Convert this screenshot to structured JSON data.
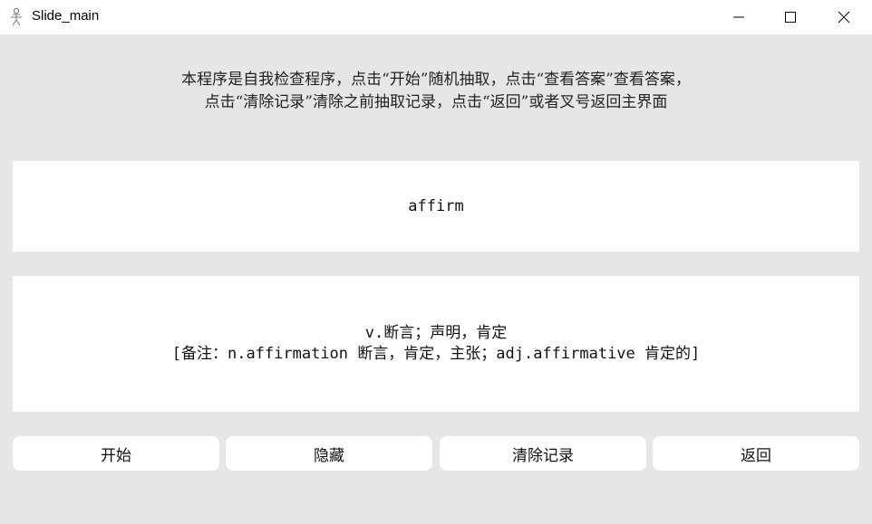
{
  "window": {
    "title": "Slide_main",
    "icon": "app-figure-icon",
    "controls": [
      "minimize-icon",
      "maximize-icon",
      "close-icon"
    ]
  },
  "instructions": {
    "line1": "本程序是自我检查程序，点击“开始”随机抽取，点击“查看答案”查看答案，",
    "line2": "点击“清除记录”清除之前抽取记录，点击“返回”或者叉号返回主界面"
  },
  "word": "affirm",
  "answer": {
    "line1": "v.断言；声明，肯定",
    "line2": "[备注：n.affirmation 断言，肯定，主张；adj.affirmative 肯定的]"
  },
  "buttons": {
    "start": "开始",
    "hide": "隐藏",
    "clear": "清除记录",
    "back": "返回"
  },
  "colors": {
    "background": "#e6e6e6",
    "panel": "#ffffff"
  }
}
